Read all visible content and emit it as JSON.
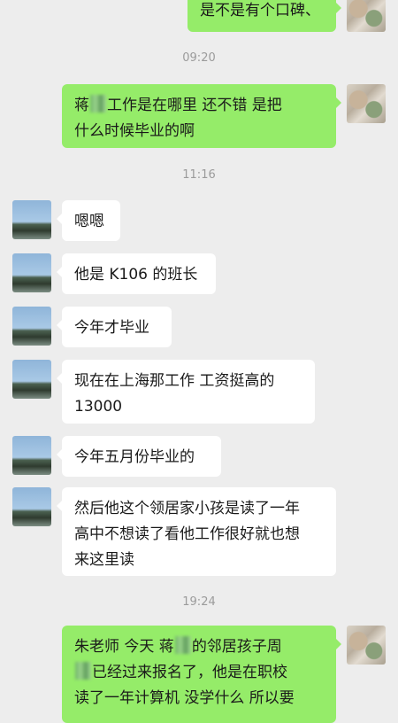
{
  "messages": [
    {
      "id": "m0",
      "side": "out",
      "lines": [
        "是不是有个口碑、"
      ]
    },
    {
      "id": "t1",
      "type": "time",
      "text": "09:20"
    },
    {
      "id": "m1",
      "side": "out",
      "parts": [
        "蒋",
        "工作是在哪里 还不错 是把",
        "什么时候毕业的啊"
      ]
    },
    {
      "id": "t2",
      "type": "time",
      "text": "11:16"
    },
    {
      "id": "m2",
      "side": "in",
      "text": "嗯嗯"
    },
    {
      "id": "m3",
      "side": "in",
      "text": "他是 K106 的班长"
    },
    {
      "id": "m4",
      "side": "in",
      "text": "今年才毕业"
    },
    {
      "id": "m5",
      "side": "in",
      "lines": [
        "现在在上海那工作 工资挺高的",
        "13000"
      ]
    },
    {
      "id": "m6",
      "side": "in",
      "text": "今年五月份毕业的"
    },
    {
      "id": "m7",
      "side": "in",
      "lines": [
        "然后他这个领居家小孩是读了一年",
        "高中不想读了看他工作很好就也想",
        "来这里读"
      ]
    },
    {
      "id": "t3",
      "type": "time",
      "text": "19:24"
    },
    {
      "id": "m8",
      "side": "out",
      "parts": [
        "朱老师 今天 蒋",
        "的邻居孩子周",
        "已经过来报名了，他是在职校",
        "读了一年计算机 没学什么  所以要"
      ]
    }
  ]
}
